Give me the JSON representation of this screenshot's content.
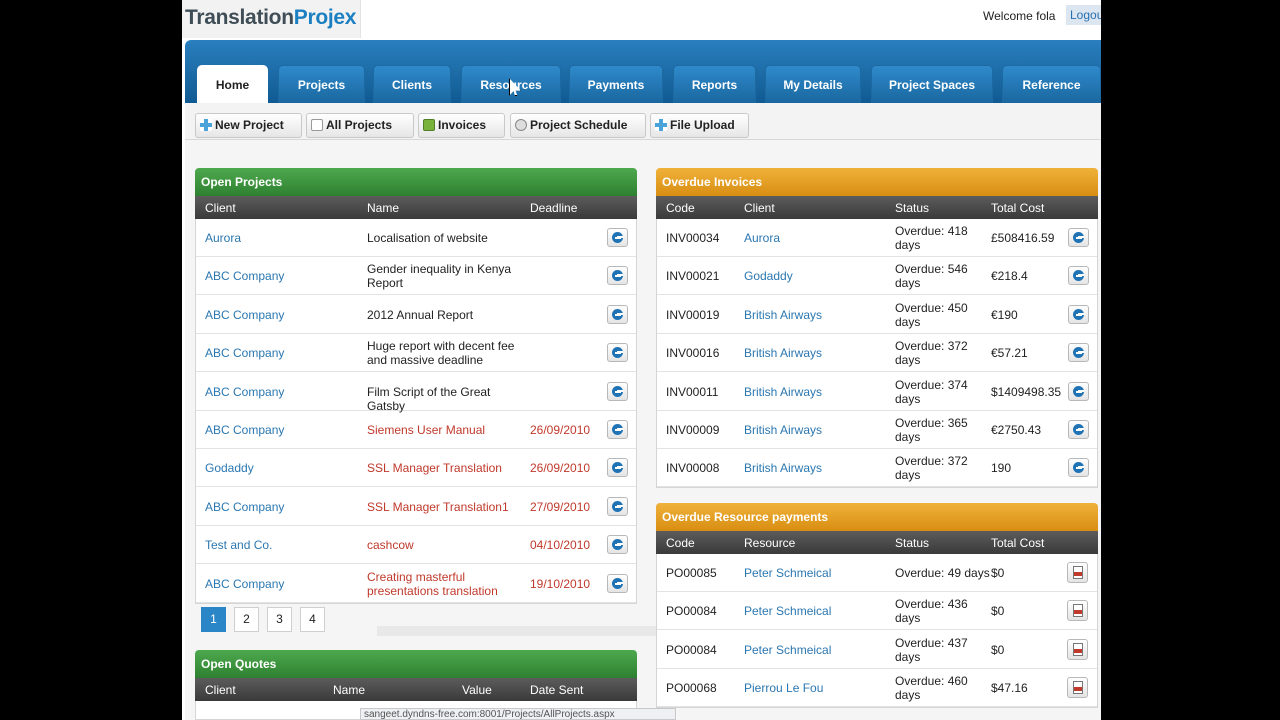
{
  "header": {
    "logo_main": "Translation",
    "logo_accent": "Projex",
    "welcome": "Welcome fola",
    "logout": "Logout"
  },
  "nav": {
    "tabs": [
      "Home",
      "Projects",
      "Clients",
      "Resources",
      "Payments",
      "Reports",
      "My Details",
      "Project Spaces",
      "Reference"
    ],
    "active": "Home"
  },
  "toolbar": {
    "new_project": "New Project",
    "all_projects": "All Projects",
    "invoices": "Invoices",
    "project_schedule": "Project Schedule",
    "file_upload": "File Upload"
  },
  "open_projects": {
    "title": "Open Projects",
    "columns": [
      "Client",
      "Name",
      "Deadline"
    ],
    "rows": [
      {
        "client": "Aurora",
        "name": "Localisation of website",
        "deadline": "",
        "overdue": false
      },
      {
        "client": "ABC Company",
        "name": "Gender inequality in Kenya Report",
        "deadline": "",
        "overdue": false
      },
      {
        "client": "ABC Company",
        "name": "2012 Annual Report",
        "deadline": "",
        "overdue": false
      },
      {
        "client": "ABC Company",
        "name": "Huge report with decent fee and massive deadline",
        "deadline": "",
        "overdue": false
      },
      {
        "client": "ABC Company",
        "name": "Film Script of the Great Gatsby",
        "deadline": "",
        "overdue": false
      },
      {
        "client": "ABC Company",
        "name": "Siemens User Manual",
        "deadline": "26/09/2010",
        "overdue": true
      },
      {
        "client": "Godaddy",
        "name": "SSL Manager Translation",
        "deadline": "26/09/2010",
        "overdue": true
      },
      {
        "client": "ABC Company",
        "name": "SSL Manager Translation1",
        "deadline": "27/09/2010",
        "overdue": true
      },
      {
        "client": "Test and Co.",
        "name": "cashcow",
        "deadline": "04/10/2010",
        "overdue": true
      },
      {
        "client": "ABC Company",
        "name": "Creating masterful presentations translation",
        "deadline": "19/10/2010",
        "overdue": true
      }
    ],
    "pages": [
      "1",
      "2",
      "3",
      "4"
    ],
    "current_page": "1"
  },
  "open_quotes": {
    "title": "Open Quotes",
    "columns": [
      "Client",
      "Name",
      "Value",
      "Date Sent"
    ]
  },
  "overdue_invoices": {
    "title": "Overdue Invoices",
    "columns": [
      "Code",
      "Client",
      "Status",
      "Total Cost"
    ],
    "rows": [
      {
        "code": "INV00034",
        "client": "Aurora",
        "status": "Overdue: 418 days",
        "total": "£508416.59"
      },
      {
        "code": "INV00021",
        "client": "Godaddy",
        "status": "Overdue: 546 days",
        "total": "€218.4"
      },
      {
        "code": "INV00019",
        "client": "British Airways",
        "status": "Overdue: 450 days",
        "total": "€190"
      },
      {
        "code": "INV00016",
        "client": "British Airways",
        "status": "Overdue: 372 days",
        "total": "€57.21"
      },
      {
        "code": "INV00011",
        "client": "British Airways",
        "status": "Overdue: 374 days",
        "total": "$1409498.35"
      },
      {
        "code": "INV00009",
        "client": "British Airways",
        "status": "Overdue: 365 days",
        "total": "€2750.43"
      },
      {
        "code": "INV00008",
        "client": "British Airways",
        "status": "Overdue: 372 days",
        "total": "190"
      }
    ]
  },
  "overdue_payments": {
    "title": "Overdue Resource payments",
    "columns": [
      "Code",
      "Resource",
      "Status",
      "Total Cost"
    ],
    "rows": [
      {
        "code": "PO00085",
        "resource": "Peter Schmeical",
        "status": "Overdue: 49 days",
        "total": "$0"
      },
      {
        "code": "PO00084",
        "resource": "Peter Schmeical",
        "status": "Overdue: 436 days",
        "total": "$0"
      },
      {
        "code": "PO00084",
        "resource": "Peter Schmeical",
        "status": "Overdue: 437 days",
        "total": "$0"
      },
      {
        "code": "PO00068",
        "resource": "Pierrou Le Fou",
        "status": "Overdue: 460 days",
        "total": "$47.16"
      }
    ]
  },
  "statusbar": {
    "url": "sangeet.dyndns-free.com:8001/Projects/AllProjects.aspx"
  },
  "colors": {
    "nav_blue": "#1a6aa5",
    "green_header": "#3f9a41",
    "orange_header": "#e59f22",
    "link": "#2b77b0",
    "overdue_red": "#c0392b"
  }
}
